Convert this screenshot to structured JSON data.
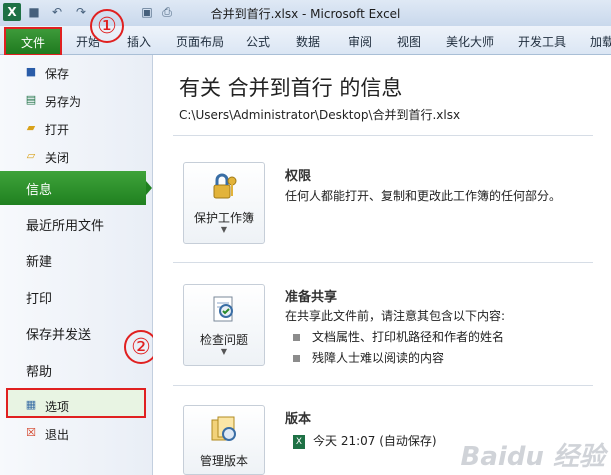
{
  "window": {
    "title": "合并到首行.xlsx - Microsoft Excel",
    "app_icon": "excel-icon"
  },
  "ribbon": {
    "file_tab": "文件",
    "tabs": [
      "开始",
      "插入",
      "页面布局",
      "公式",
      "数据",
      "审阅",
      "视图",
      "美化大师",
      "开发工具",
      "加载"
    ]
  },
  "nav": {
    "save": "保存",
    "save_as": "另存为",
    "open": "打开",
    "close": "关闭",
    "info": "信息",
    "recent": "最近所用文件",
    "new": "新建",
    "print": "打印",
    "save_send": "保存并发送",
    "help": "帮助",
    "options": "选项",
    "exit": "退出"
  },
  "callouts": {
    "one": "①",
    "two": "②"
  },
  "info": {
    "title": "有关 合并到首行 的信息",
    "path": "C:\\Users\\Administrator\\Desktop\\合并到首行.xlsx",
    "permissions": {
      "button": "保护工作簿",
      "heading": "权限",
      "text": "任何人都能打开、复制和更改此工作簿的任何部分。"
    },
    "prepare": {
      "button": "检查问题",
      "heading": "准备共享",
      "text": "在共享此文件前，请注意其包含以下内容:",
      "items": [
        "文档属性、打印机路径和作者的姓名",
        "残障人士难以阅读的内容"
      ]
    },
    "versions": {
      "button": "管理版本",
      "heading": "版本",
      "entry": "今天 21:07 (自动保存)"
    }
  },
  "watermark": "Baidu 经验",
  "colors": {
    "accent_green": "#208020",
    "highlight_red": "#e02020"
  }
}
